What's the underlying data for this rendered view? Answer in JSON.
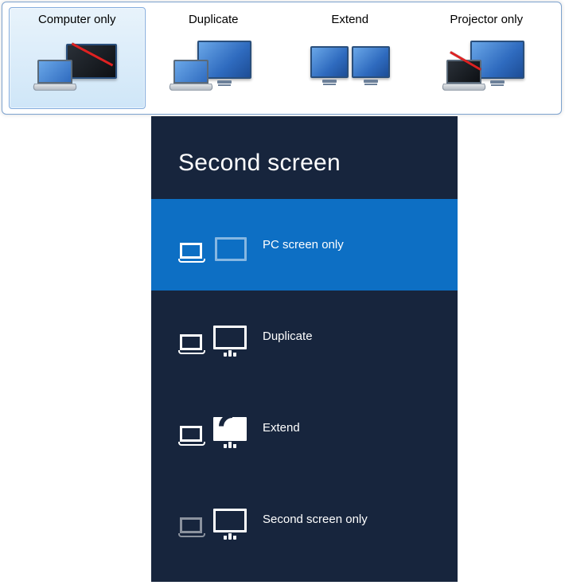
{
  "win7": {
    "options": [
      {
        "id": "computer-only",
        "label": "Computer only",
        "selected": true
      },
      {
        "id": "duplicate",
        "label": "Duplicate",
        "selected": false
      },
      {
        "id": "extend",
        "label": "Extend",
        "selected": false
      },
      {
        "id": "projector-only",
        "label": "Projector only",
        "selected": false
      }
    ]
  },
  "win8": {
    "title": "Second screen",
    "options": [
      {
        "id": "pc-screen-only",
        "label": "PC screen only",
        "selected": true
      },
      {
        "id": "duplicate",
        "label": "Duplicate",
        "selected": false
      },
      {
        "id": "extend",
        "label": "Extend",
        "selected": false
      },
      {
        "id": "second-screen-only",
        "label": "Second screen only",
        "selected": false
      }
    ]
  }
}
